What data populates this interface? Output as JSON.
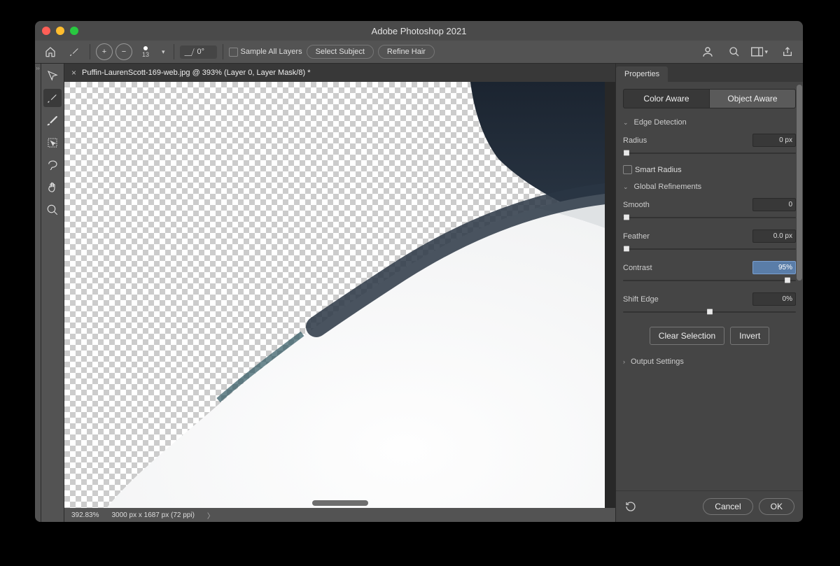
{
  "window": {
    "title": "Adobe Photoshop 2021"
  },
  "optionsbar": {
    "brush_size": "13",
    "angle": "0°",
    "sample_all_layers": "Sample All Layers",
    "select_subject": "Select Subject",
    "refine_hair": "Refine Hair"
  },
  "document": {
    "tab_title": "Puffin-LaurenScott-169-web.jpg @ 393% (Layer 0, Layer Mask/8) *"
  },
  "status": {
    "zoom": "392.83%",
    "dims": "3000 px x 1687 px (72 ppi)"
  },
  "panel": {
    "tab": "Properties",
    "mode_color": "Color Aware",
    "mode_object": "Object Aware",
    "sections": {
      "edge": "Edge Detection",
      "global": "Global Refinements",
      "output": "Output Settings"
    },
    "edge": {
      "radius_label": "Radius",
      "radius_value": "0 px",
      "smart_radius": "Smart Radius"
    },
    "global": {
      "smooth_label": "Smooth",
      "smooth_value": "0",
      "feather_label": "Feather",
      "feather_value": "0.0 px",
      "contrast_label": "Contrast",
      "contrast_value": "95%",
      "shift_label": "Shift Edge",
      "shift_value": "0%"
    },
    "buttons": {
      "clear": "Clear Selection",
      "invert": "Invert"
    }
  },
  "footer": {
    "cancel": "Cancel",
    "ok": "OK"
  }
}
